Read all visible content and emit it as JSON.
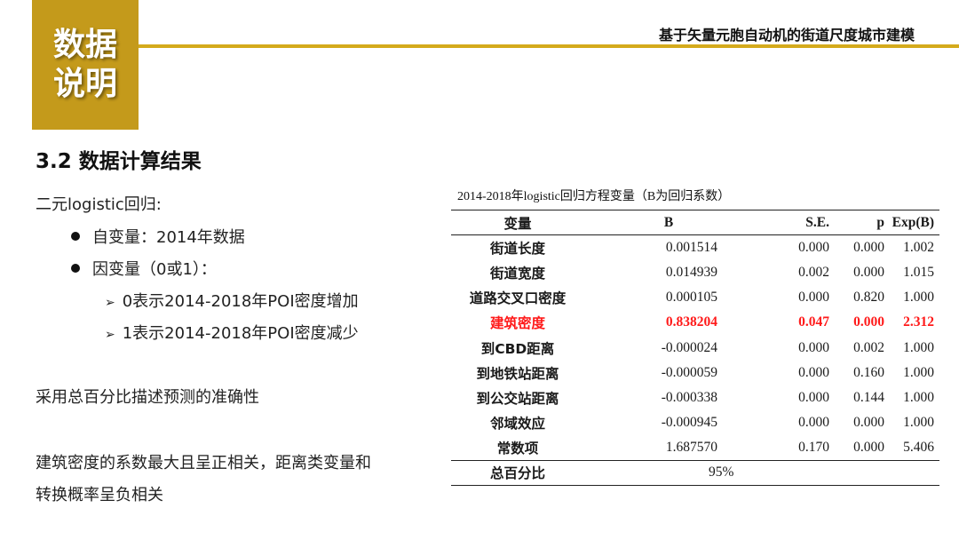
{
  "badge": {
    "line1": "数据",
    "line2": "说明"
  },
  "header_title": "基于矢量元胞自动机的街道尺度城市建模",
  "section_title": "3.2 数据计算结果",
  "left": {
    "intro": "二元logistic回归:",
    "bullet1": "自变量：2014年数据",
    "bullet2": "因变量（0或1）：",
    "sub1": "0表示2014-2018年POI密度增加",
    "sub2": "1表示2014-2018年POI密度减少",
    "para1": "采用总百分比描述预测的准确性",
    "para2_line1": "建筑密度的系数最大且呈正相关，距离类变量和",
    "para2_line2": "转换概率呈负相关"
  },
  "table": {
    "caption": "2014-2018年logistic回归方程变量（B为回归系数）",
    "headers": [
      "变量",
      "B",
      "S.E.",
      "p",
      "Exp(B)"
    ],
    "rows": [
      [
        "街道长度",
        "0.001514",
        "0.000",
        "0.000",
        "1.002"
      ],
      [
        "街道宽度",
        "0.014939",
        "0.002",
        "0.000",
        "1.015"
      ],
      [
        "道路交叉口密度",
        "0.000105",
        "0.000",
        "0.820",
        "1.000"
      ],
      [
        "建筑密度",
        "0.838204",
        "0.047",
        "0.000",
        "2.312"
      ],
      [
        "到CBD距离",
        "-0.000024",
        "0.000",
        "0.002",
        "1.000"
      ],
      [
        "到地铁站距离",
        "-0.000059",
        "0.000",
        "0.160",
        "1.000"
      ],
      [
        "到公交站距离",
        "-0.000338",
        "0.000",
        "0.144",
        "1.000"
      ],
      [
        "邻域效应",
        "-0.000945",
        "0.000",
        "0.000",
        "1.000"
      ],
      [
        "常数项",
        "1.687570",
        "0.170",
        "0.000",
        "5.406"
      ]
    ],
    "total_label": "总百分比",
    "total_value": "95%",
    "highlight_color": "#ff1a1a"
  }
}
